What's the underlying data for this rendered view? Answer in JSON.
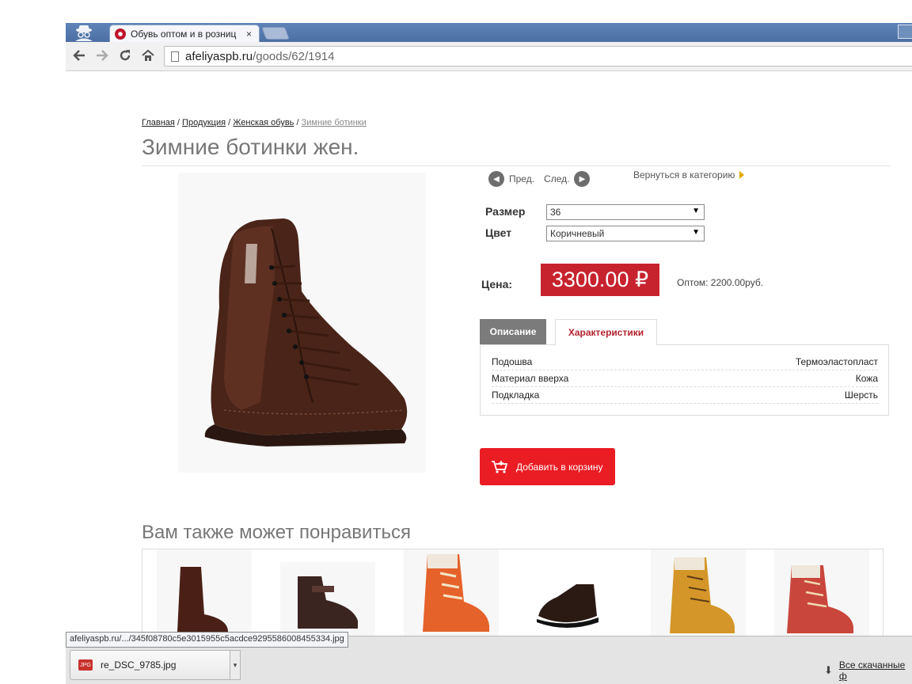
{
  "browser": {
    "tab_title": "Обувь оптом и в розниц",
    "tab_close": "×",
    "url_host": "afeliyaspb.ru",
    "url_path": "/goods/62/1914",
    "status_url": "afeliyaspb.ru/.../345f08780c5e3015955c5acdce9295586008455334.jpg"
  },
  "breadcrumb": {
    "home": "Главная",
    "products": "Продукция",
    "womens": "Женская обувь",
    "current": "Зимние ботинки",
    "sep": " / "
  },
  "product": {
    "title": "Зимние ботинки жен.",
    "prev_label": "Пред.",
    "next_label": "След.",
    "back_to_category": "Вернуться в категорию",
    "size_label": "Размер",
    "size_value": "36",
    "color_label": "Цвет",
    "color_value": "Коричневый",
    "price_label": "Цена:",
    "price": "3300.00 ₽",
    "wholesale": "Оптом: 2200.00руб.",
    "add_to_cart": "Добавить в корзину"
  },
  "tabs": {
    "description": "Описание",
    "specs": "Характеристики"
  },
  "specs": [
    {
      "name": "Подошва",
      "value": "Термоэластопласт"
    },
    {
      "name": "Материал вверха",
      "value": "Кожа"
    },
    {
      "name": "Подкладка",
      "value": "Шерсть"
    }
  ],
  "also_like": {
    "title": "Вам также может понравиться"
  },
  "downloads": {
    "file_name": "re_DSC_9785.jpg",
    "file_type": "JPG",
    "all_downloads": "Все скачанные ф"
  },
  "colors": {
    "accent_red": "#c7232f",
    "cart_red": "#ea1c24",
    "tab_active": "#b3242f"
  }
}
